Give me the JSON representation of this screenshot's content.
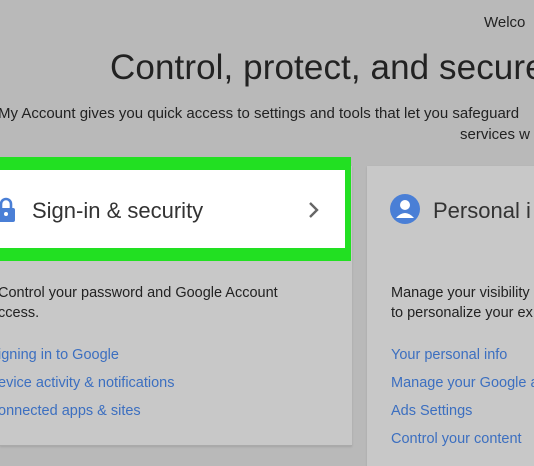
{
  "header": {
    "welcome": "Welco",
    "headline": "Control, protect, and secure",
    "subtitle_line1": "My Account gives you quick access to settings and tools that let you safeguard",
    "subtitle_line2": "services w"
  },
  "cards": {
    "signin": {
      "title": "Sign-in & security",
      "icon": "lock-icon",
      "description_line1": "Control your password and Google Account",
      "description_line2": "ccess.",
      "links": [
        "igning in to Google",
        "evice activity & notifications",
        "onnected apps & sites"
      ]
    },
    "personal": {
      "title": "Personal i",
      "icon": "person-icon",
      "description_line1": "Manage your visibility",
      "description_line2": "to personalize your ex",
      "links": [
        "Your personal info",
        "Manage your Google a",
        "Ads Settings",
        "Control your content"
      ]
    }
  },
  "colors": {
    "highlight": "#22e022",
    "link": "#3c6fc0",
    "icon_blue": "#4a7fd6",
    "background": "#b9b9b9"
  }
}
